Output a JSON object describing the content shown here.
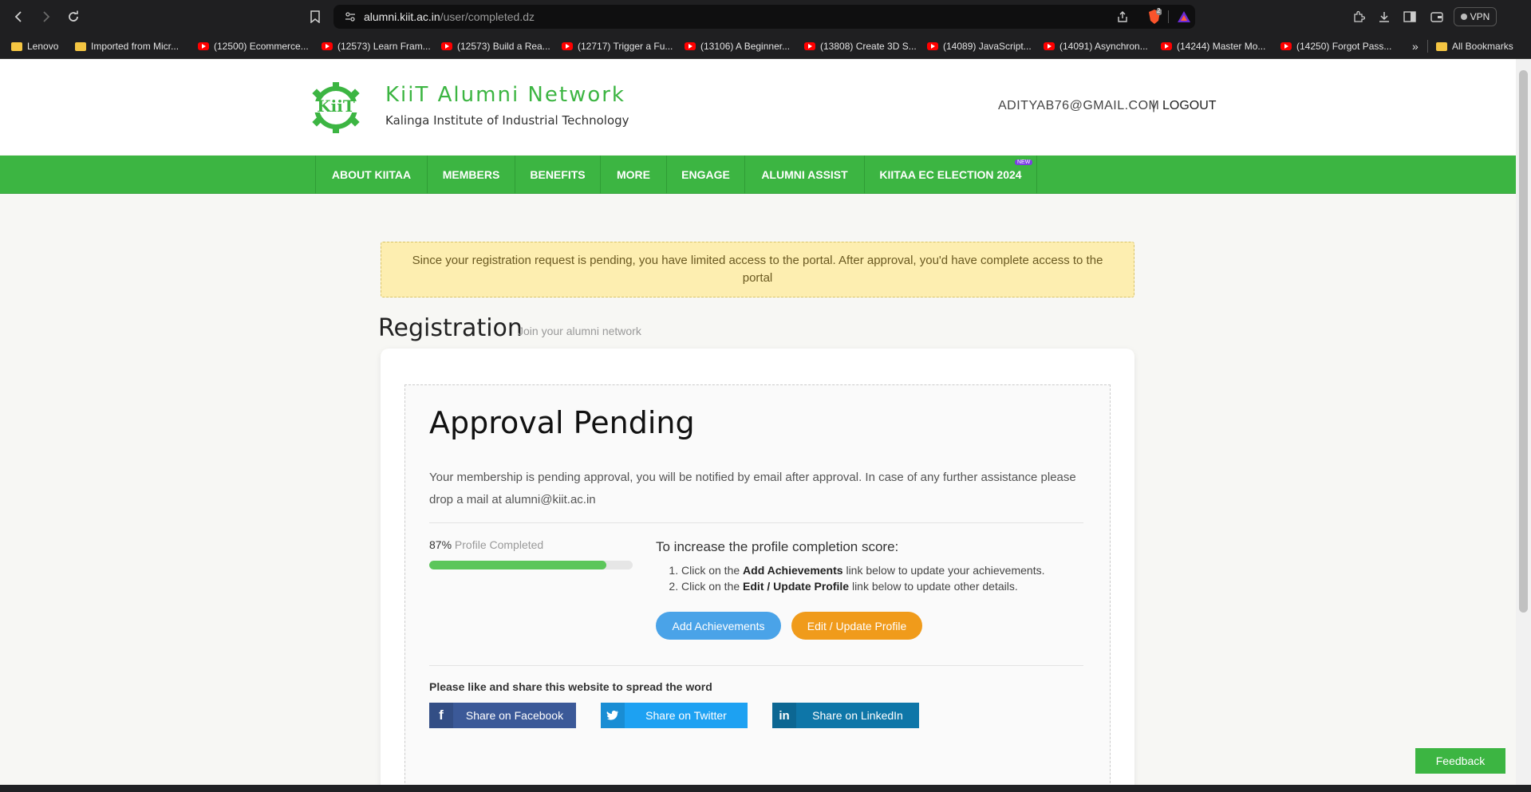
{
  "browser": {
    "url_host": "alumni.kiit.ac.in",
    "url_path": "/user/completed.dz",
    "brave_badge": "2",
    "vpn_label": "VPN",
    "bookmarks": [
      {
        "type": "folder",
        "label": "Lenovo"
      },
      {
        "type": "folder",
        "label": "Imported from Micr..."
      },
      {
        "type": "youtube",
        "label": "(12500) Ecommerce..."
      },
      {
        "type": "youtube",
        "label": "(12573) Learn Fram..."
      },
      {
        "type": "youtube",
        "label": "(12573) Build a Rea..."
      },
      {
        "type": "youtube",
        "label": "(12717) Trigger a Fu..."
      },
      {
        "type": "youtube",
        "label": "(13106) A Beginner..."
      },
      {
        "type": "youtube",
        "label": "(13808) Create 3D S..."
      },
      {
        "type": "youtube",
        "label": "(14089) JavaScript..."
      },
      {
        "type": "youtube",
        "label": "(14091) Asynchron..."
      },
      {
        "type": "youtube",
        "label": "(14244) Master Mo..."
      },
      {
        "type": "youtube",
        "label": "(14250) Forgot Pass..."
      }
    ],
    "more_label": "»",
    "all_bookmarks": "All Bookmarks"
  },
  "header": {
    "brand": "KiiT Alumni Network",
    "brand_sub": "Kalinga Institute of Industrial Technology",
    "user_email": "ADITYAB76@GMAIL.COM",
    "separator": "|",
    "logout": "LOGOUT"
  },
  "nav": {
    "items": [
      "ABOUT KIITAA",
      "MEMBERS",
      "BENEFITS",
      "MORE",
      "ENGAGE",
      "ALUMNI ASSIST",
      "KIITAA EC ELECTION 2024"
    ],
    "new_badge": "NEW"
  },
  "alert": "Since your registration request is pending, you have limited access to the portal. After approval, you'd have complete access to the portal",
  "registration": {
    "title": "Registration",
    "subtitle": "Join your alumni network"
  },
  "approval": {
    "title": "Approval Pending",
    "message": "Your membership is pending approval, you will be notified by email after approval. In case of any further assistance please drop a mail at alumni@kiit.ac.in",
    "percent_text": "87%",
    "percent_value": 87,
    "percent_label": "Profile Completed",
    "increase_title": "To increase the profile completion score:",
    "steps": [
      {
        "pre": "Click on the ",
        "bold": "Add Achievements",
        "post": " link below to update your achievements."
      },
      {
        "pre": "Click on the ",
        "bold": "Edit / Update Profile",
        "post": " link below to update other details."
      }
    ],
    "add_achievements": "Add Achievements",
    "edit_profile": "Edit / Update Profile"
  },
  "share": {
    "title": "Please like and share this website to spread the word",
    "facebook": "Share on Facebook",
    "twitter": "Share on Twitter",
    "linkedin": "Share on LinkedIn"
  },
  "feedback": "Feedback",
  "colors": {
    "brand_green": "#3cb542",
    "alert_bg": "#fdeeb0",
    "progress_fill": "#5cc65a",
    "btn_blue": "#4aa3e8",
    "btn_orange": "#f09b1b"
  }
}
